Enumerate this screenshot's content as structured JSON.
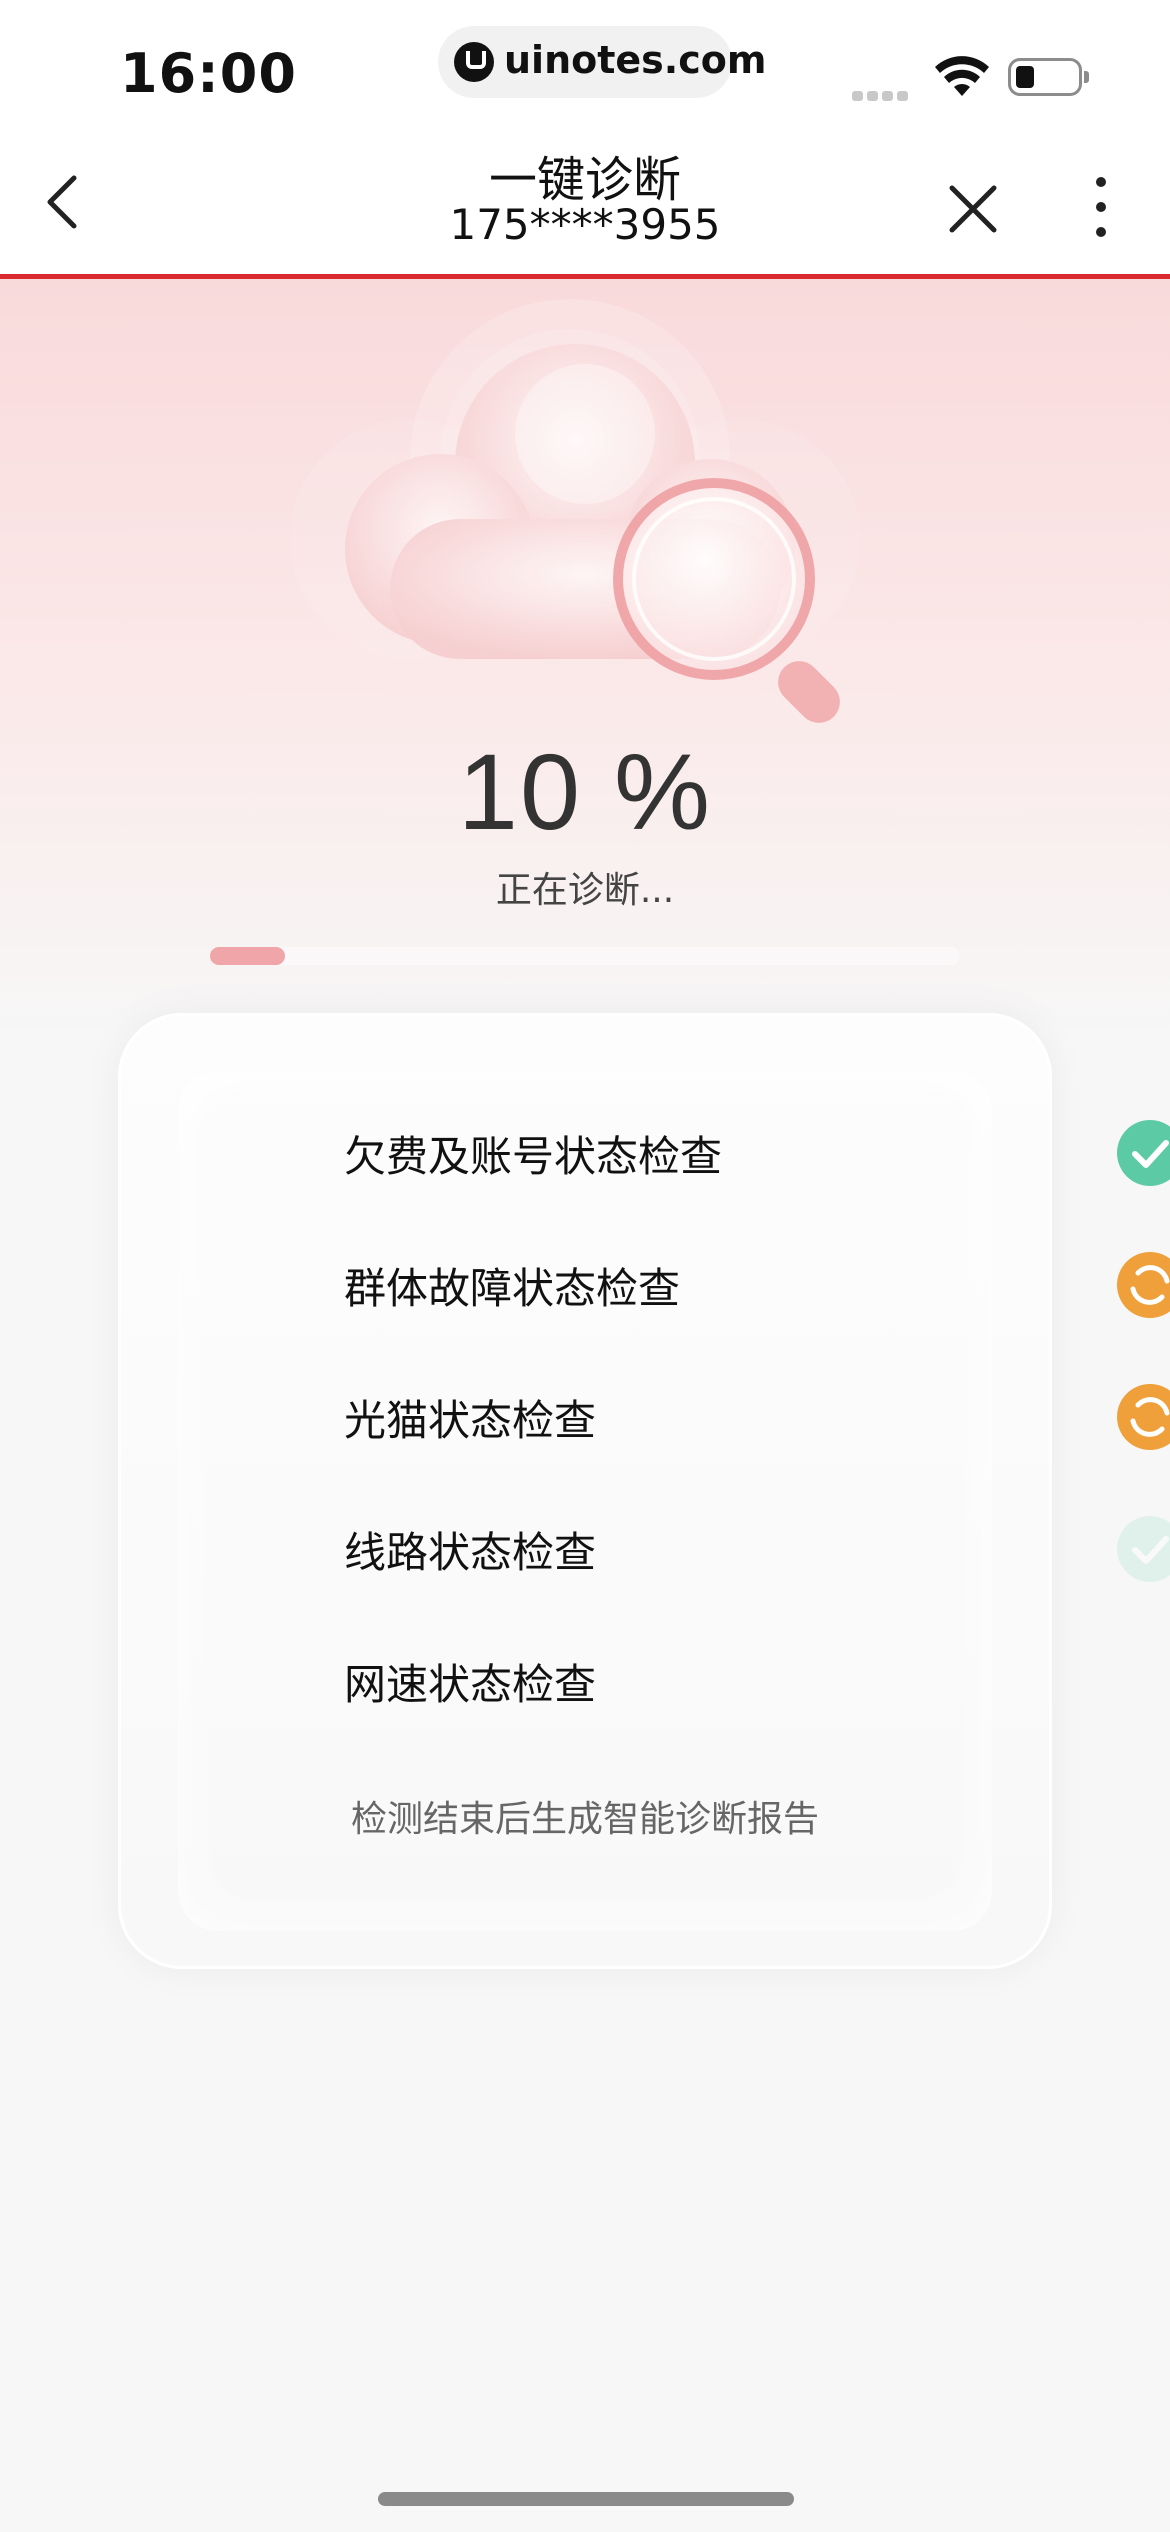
{
  "status_bar": {
    "time": "16:00",
    "url": "uinotes.com"
  },
  "nav": {
    "title": "一键诊断",
    "subtitle": "175****3955",
    "icons": {
      "back": "chevron-left-icon",
      "close": "close-icon",
      "more": "more-vertical-icon"
    }
  },
  "hero": {
    "illustration": "cloud-magnifier-illustration",
    "progress_percent": 10,
    "progress_label": "10 %",
    "status_text": "正在诊断..."
  },
  "checks": [
    {
      "label": "欠费及账号状态检查",
      "state": "done",
      "icon": "check-circle-icon"
    },
    {
      "label": "群体故障状态检查",
      "state": "running",
      "icon": "loading-spinner-icon"
    },
    {
      "label": "光猫状态检查",
      "state": "running",
      "icon": "loading-spinner-icon"
    },
    {
      "label": "线路状态检查",
      "state": "pending-faded",
      "icon": "check-circle-icon"
    },
    {
      "label": "网速状态检查",
      "state": "pending",
      "icon": ""
    }
  ],
  "footer_note": "检测结束后生成智能诊断报告",
  "colors": {
    "accent_red": "#d92a2f",
    "done_green": "#5ccba5",
    "running_orange": "#f0a03a",
    "progress_fill": "#f0a6a8"
  }
}
